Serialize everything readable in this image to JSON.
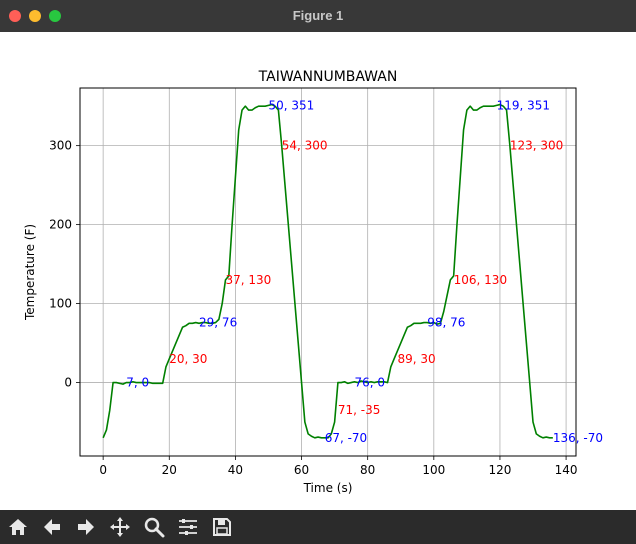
{
  "window": {
    "title": "Figure 1",
    "buttons": [
      {
        "name": "close-window-button",
        "color": "#ff5f57"
      },
      {
        "name": "minimize-window-button",
        "color": "#febc2e"
      },
      {
        "name": "zoom-window-button",
        "color": "#28c840"
      }
    ]
  },
  "toolbar": {
    "tools": [
      "home-icon",
      "back-arrow-icon",
      "forward-arrow-icon",
      "pan-icon",
      "zoom-magnifier-icon",
      "configure-subplots-icon",
      "save-icon"
    ]
  },
  "chart_data": {
    "type": "line",
    "title": "TAIWANNUMBAWAN",
    "xlabel": "Time (s)",
    "ylabel": "Temperature (F)",
    "xlim": [
      -7,
      143
    ],
    "ylim": [
      -93,
      373
    ],
    "xticks": [
      0,
      20,
      40,
      60,
      80,
      100,
      120,
      140
    ],
    "yticks": [
      0,
      100,
      200,
      300
    ],
    "grid": true,
    "line_color": "#008000",
    "series": [
      {
        "x": [
          0,
          1,
          2,
          3,
          4,
          5,
          6,
          7,
          8,
          9,
          10,
          11,
          12,
          13,
          14,
          15,
          16,
          17,
          18,
          19,
          20,
          21,
          22,
          23,
          24,
          25,
          26,
          27,
          28,
          29,
          30,
          31,
          32,
          33,
          34,
          35,
          36,
          37,
          38,
          39,
          40,
          41,
          42,
          43,
          44,
          45,
          46,
          47,
          48,
          49,
          50,
          51,
          52,
          53,
          54,
          55,
          56,
          57,
          58,
          59,
          60,
          61,
          62,
          63,
          64,
          65,
          66,
          67,
          68,
          69,
          70,
          71,
          72,
          73,
          74,
          75,
          76,
          77,
          78,
          79,
          80,
          81,
          82,
          83,
          84,
          85,
          86,
          87,
          88,
          89,
          90,
          91,
          92,
          93,
          94,
          95,
          96,
          97,
          98,
          99,
          100,
          101,
          102,
          103,
          104,
          105,
          106,
          107,
          108,
          109,
          110,
          111,
          112,
          113,
          114,
          115,
          116,
          117,
          118,
          119,
          120,
          121,
          122,
          123,
          124,
          125,
          126,
          127,
          128,
          129,
          130,
          131,
          132,
          133,
          134,
          135,
          136
        ],
        "y": [
          -70,
          -60,
          -35,
          0,
          0,
          -1,
          -2,
          0,
          0,
          1,
          0,
          0,
          0,
          0,
          0,
          -1,
          -1,
          -1,
          -1,
          20,
          30,
          40,
          50,
          60,
          70,
          72,
          75,
          75,
          76,
          75,
          76,
          76,
          75,
          75,
          76,
          80,
          100,
          130,
          135,
          200,
          260,
          320,
          345,
          350,
          345,
          345,
          348,
          350,
          350,
          350,
          351,
          352,
          350,
          345,
          300,
          250,
          200,
          150,
          100,
          50,
          0,
          -50,
          -65,
          -68,
          -70,
          -69,
          -70,
          -70,
          -70,
          -65,
          -50,
          0,
          0,
          1,
          -1,
          0,
          1,
          0,
          2,
          1,
          0,
          1,
          0,
          1,
          1,
          1,
          0,
          20,
          30,
          40,
          50,
          60,
          70,
          72,
          75,
          75,
          75,
          76,
          76,
          75,
          76,
          74,
          75,
          90,
          110,
          130,
          135,
          200,
          260,
          320,
          345,
          350,
          345,
          345,
          348,
          350,
          350,
          350,
          350,
          351,
          352,
          350,
          345,
          300,
          250,
          200,
          150,
          100,
          50,
          0,
          -50,
          -65,
          -68,
          -70,
          -69,
          -70,
          -70
        ]
      }
    ],
    "annotations": [
      {
        "x": 7,
        "y": 0,
        "text": "7, 0",
        "color": "#0000ff"
      },
      {
        "x": 20,
        "y": 30,
        "text": "20, 30",
        "color": "#ff0000"
      },
      {
        "x": 29,
        "y": 76,
        "text": "29, 76",
        "color": "#0000ff"
      },
      {
        "x": 37,
        "y": 130,
        "text": "37, 130",
        "color": "#ff0000"
      },
      {
        "x": 50,
        "y": 351,
        "text": "50, 351",
        "color": "#0000ff"
      },
      {
        "x": 54,
        "y": 300,
        "text": "54, 300",
        "color": "#ff0000"
      },
      {
        "x": 67,
        "y": -70,
        "text": "67, -70",
        "color": "#0000ff"
      },
      {
        "x": 71,
        "y": -35,
        "text": "71, -35",
        "color": "#ff0000"
      },
      {
        "x": 76,
        "y": 0,
        "text": "76, 0",
        "color": "#0000ff"
      },
      {
        "x": 89,
        "y": 30,
        "text": "89, 30",
        "color": "#ff0000"
      },
      {
        "x": 98,
        "y": 76,
        "text": "98, 76",
        "color": "#0000ff"
      },
      {
        "x": 106,
        "y": 130,
        "text": "106, 130",
        "color": "#ff0000"
      },
      {
        "x": 119,
        "y": 351,
        "text": "119, 351",
        "color": "#0000ff"
      },
      {
        "x": 123,
        "y": 300,
        "text": "123, 300",
        "color": "#ff0000"
      },
      {
        "x": 136,
        "y": -70,
        "text": "136, -70",
        "color": "#0000ff"
      }
    ]
  }
}
